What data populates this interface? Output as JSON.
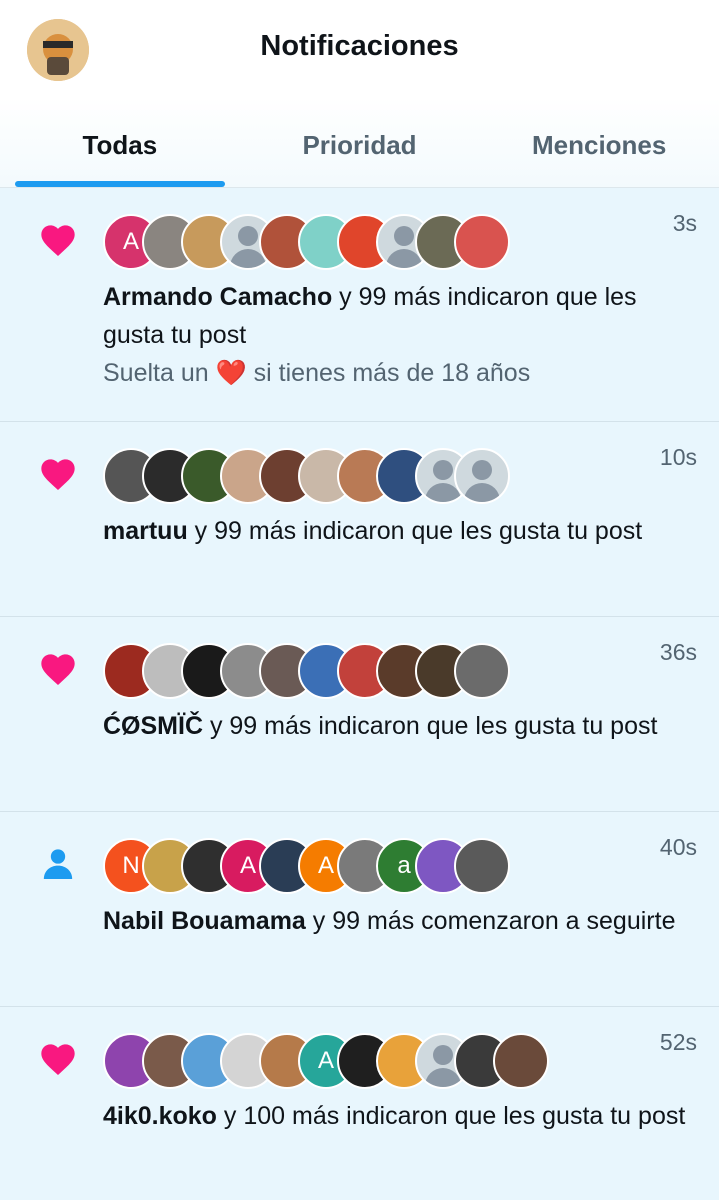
{
  "header": {
    "title": "Notificaciones"
  },
  "tabs": [
    {
      "label": "Todas",
      "active": true
    },
    {
      "label": "Prioridad",
      "active": false
    },
    {
      "label": "Menciones",
      "active": false
    }
  ],
  "colors": {
    "accent": "#1d9bf0",
    "like": "#f91880",
    "follow": "#1d9bf0",
    "feed_bg": "#e8f6fd"
  },
  "notifications": [
    {
      "icon": "heart-icon",
      "time": "3s",
      "name": "Armando Camacho",
      "action": " y 99 más indicaron que les gusta tu post",
      "preview": "Suelta un ❤️ si tienes más de 18 años",
      "avatars": [
        {
          "bg": "#d6336c",
          "letter": "A"
        },
        {
          "bg": "#8a8580",
          "letter": ""
        },
        {
          "bg": "#c79a5c",
          "letter": ""
        },
        {
          "bg": "default",
          "letter": ""
        },
        {
          "bg": "#b0523a",
          "letter": ""
        },
        {
          "bg": "#7fd1c8",
          "letter": ""
        },
        {
          "bg": "#e0452b",
          "letter": ""
        },
        {
          "bg": "default",
          "letter": ""
        },
        {
          "bg": "#6b6a55",
          "letter": ""
        },
        {
          "bg": "#d9534f",
          "letter": ""
        }
      ]
    },
    {
      "icon": "heart-icon",
      "time": "10s",
      "name": "martuu",
      "action": " y 99 más indicaron que les gusta tu post",
      "avatars": [
        {
          "bg": "#555555",
          "letter": ""
        },
        {
          "bg": "#2b2b2b",
          "letter": ""
        },
        {
          "bg": "#3a5a2a",
          "letter": ""
        },
        {
          "bg": "#caa58a",
          "letter": ""
        },
        {
          "bg": "#6d3f30",
          "letter": ""
        },
        {
          "bg": "#c9b8a8",
          "letter": ""
        },
        {
          "bg": "#b97a55",
          "letter": ""
        },
        {
          "bg": "#2f4f7f",
          "letter": ""
        },
        {
          "bg": "default",
          "letter": ""
        },
        {
          "bg": "default",
          "letter": ""
        }
      ]
    },
    {
      "icon": "heart-icon",
      "time": "36s",
      "name": "ĆØSMÏČ",
      "action": " y 99 más indicaron que les gusta tu post",
      "avatars": [
        {
          "bg": "#9c2a1f",
          "letter": ""
        },
        {
          "bg": "#bdbdbd",
          "letter": ""
        },
        {
          "bg": "#1a1a1a",
          "letter": ""
        },
        {
          "bg": "#8c8c8c",
          "letter": ""
        },
        {
          "bg": "#6a5a55",
          "letter": ""
        },
        {
          "bg": "#3b6fb6",
          "letter": ""
        },
        {
          "bg": "#c2413b",
          "letter": ""
        },
        {
          "bg": "#5a3b2a",
          "letter": ""
        },
        {
          "bg": "#4a3a2a",
          "letter": ""
        },
        {
          "bg": "#6b6b6b",
          "letter": ""
        }
      ]
    },
    {
      "icon": "person-icon",
      "time": "40s",
      "name": "Nabil Bouamama",
      "action": " y 99 más comenzaron a seguirte",
      "avatars": [
        {
          "bg": "#f4511e",
          "letter": "N"
        },
        {
          "bg": "#c8a24a",
          "letter": ""
        },
        {
          "bg": "#2f2f2f",
          "letter": ""
        },
        {
          "bg": "#d81b60",
          "letter": "A"
        },
        {
          "bg": "#2a3d55",
          "letter": ""
        },
        {
          "bg": "#f57c00",
          "letter": "A"
        },
        {
          "bg": "#7a7a7a",
          "letter": ""
        },
        {
          "bg": "#2e7d32",
          "letter": "a"
        },
        {
          "bg": "#7e57c2",
          "letter": ""
        },
        {
          "bg": "#5a5a5a",
          "letter": ""
        }
      ]
    },
    {
      "icon": "heart-icon",
      "time": "52s",
      "name": "4ik0.koko",
      "action": " y 100 más indicaron que les gusta tu post",
      "avatars": [
        {
          "bg": "#8e44ad",
          "letter": ""
        },
        {
          "bg": "#7a5a4a",
          "letter": ""
        },
        {
          "bg": "#5aa0d8",
          "letter": ""
        },
        {
          "bg": "#d4d4d4",
          "letter": ""
        },
        {
          "bg": "#b57a4a",
          "letter": ""
        },
        {
          "bg": "#26a69a",
          "letter": "A"
        },
        {
          "bg": "#1f1f1f",
          "letter": ""
        },
        {
          "bg": "#e8a23a",
          "letter": ""
        },
        {
          "bg": "default",
          "letter": ""
        },
        {
          "bg": "#3a3a3a",
          "letter": ""
        },
        {
          "bg": "#6a4a3a",
          "letter": ""
        }
      ]
    }
  ]
}
